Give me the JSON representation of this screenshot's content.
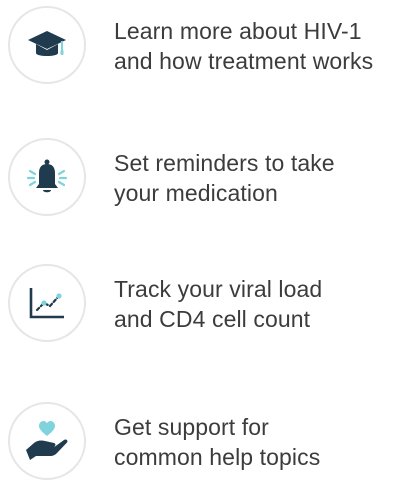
{
  "features": [
    {
      "icon": "graduation-cap-icon",
      "line1": "Learn more about HIV-1",
      "line2": "and how treatment works"
    },
    {
      "icon": "bell-icon",
      "line1": "Set reminders to take",
      "line2": "your medication"
    },
    {
      "icon": "line-chart-icon",
      "line1": "Track your viral load",
      "line2": "and CD4 cell count"
    },
    {
      "icon": "hand-heart-icon",
      "line1": "Get support for",
      "line2": "common help topics"
    }
  ],
  "colors": {
    "icon_dark": "#1f3b4d",
    "icon_accent": "#7fd3dc",
    "circle_border": "#e4e6e8",
    "text": "#3c3c3c"
  }
}
